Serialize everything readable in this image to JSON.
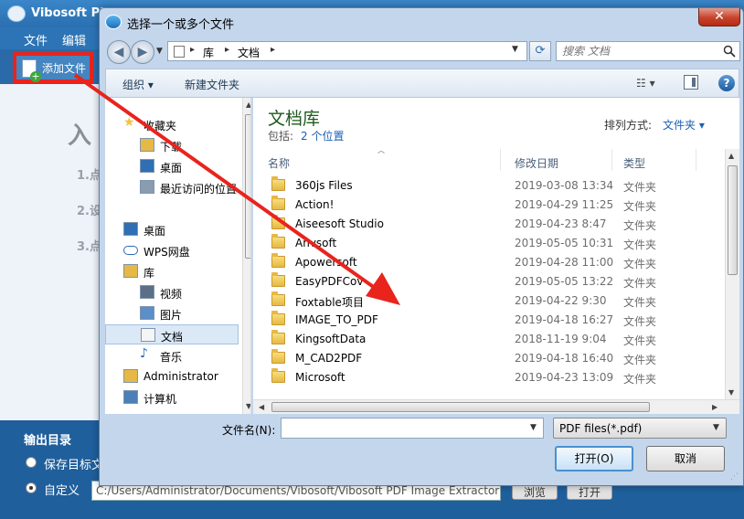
{
  "background_app": {
    "title": "Vibosoft PD",
    "menus": [
      "文件",
      "编辑"
    ],
    "add_file_label": "添加文件",
    "heading": "入",
    "steps": [
      "1.点",
      "2.设",
      "3.点"
    ],
    "output_label": "输出目录",
    "radio_options": [
      {
        "label": "保存目标文",
        "selected": false
      },
      {
        "label": "自定义",
        "selected": true
      }
    ],
    "path_value": "C:/Users/Administrator/Documents/Vibosoft/Vibosoft PDF Image Extractor",
    "buttons": [
      "浏览",
      "打开"
    ]
  },
  "dialog": {
    "title": "选择一个或多个文件",
    "close_symbol": "✕",
    "breadcrumbs": [
      "库",
      "文档"
    ],
    "search_placeholder": "搜索 文档",
    "toolbar": {
      "organize": "组织 ▾",
      "new_folder": "新建文件夹",
      "help_symbol": "?"
    },
    "nav_items": [
      {
        "label": "收藏夹",
        "icon": "star-icon",
        "level": 0,
        "selected": false
      },
      {
        "label": "下载",
        "icon": "download-folder-icon",
        "level": 1,
        "selected": false
      },
      {
        "label": "桌面",
        "icon": "desktop-icon",
        "level": 1,
        "selected": false
      },
      {
        "label": "最近访问的位置",
        "icon": "recent-places-icon",
        "level": 1,
        "selected": false
      },
      {
        "label": "桌面",
        "icon": "desktop-icon",
        "level": 0,
        "selected": false
      },
      {
        "label": "WPS网盘",
        "icon": "cloud-icon",
        "level": 0,
        "selected": false
      },
      {
        "label": "库",
        "icon": "library-icon",
        "level": 0,
        "selected": false
      },
      {
        "label": "视频",
        "icon": "video-icon",
        "level": 1,
        "selected": false
      },
      {
        "label": "图片",
        "icon": "pictures-icon",
        "level": 1,
        "selected": false
      },
      {
        "label": "文档",
        "icon": "documents-icon",
        "level": 1,
        "selected": true
      },
      {
        "label": "音乐",
        "icon": "music-icon",
        "level": 1,
        "selected": false
      },
      {
        "label": "Administrator",
        "icon": "user-folder-icon",
        "level": 0,
        "selected": false
      },
      {
        "label": "计算机",
        "icon": "computer-icon",
        "level": 0,
        "selected": false
      }
    ],
    "library": {
      "title": "文档库",
      "includes_label": "包括:",
      "includes_value": "2 个位置",
      "sort_label": "排列方式:",
      "sort_value": "文件夹 ▾"
    },
    "columns": {
      "name": "名称",
      "date": "修改日期",
      "type": "类型"
    },
    "files": [
      {
        "name": "360js Files",
        "date": "2019-03-08 13:34",
        "type": "文件夹"
      },
      {
        "name": "Action!",
        "date": "2019-04-29 11:25",
        "type": "文件夹"
      },
      {
        "name": "Aiseesoft Studio",
        "date": "2019-04-23 8:47",
        "type": "文件夹"
      },
      {
        "name": "Anvsoft",
        "date": "2019-05-05 10:31",
        "type": "文件夹"
      },
      {
        "name": "Apowersoft",
        "date": "2019-04-28 11:00",
        "type": "文件夹"
      },
      {
        "name": "EasyPDFCov",
        "date": "2019-05-05 13:22",
        "type": "文件夹"
      },
      {
        "name": "Foxtable项目",
        "date": "2019-04-22 9:30",
        "type": "文件夹"
      },
      {
        "name": "IMAGE_TO_PDF",
        "date": "2019-04-18 16:27",
        "type": "文件夹"
      },
      {
        "name": "KingsoftData",
        "date": "2018-11-19 9:04",
        "type": "文件夹"
      },
      {
        "name": "M_CAD2PDF",
        "date": "2019-04-18 16:40",
        "type": "文件夹"
      },
      {
        "name": "Microsoft",
        "date": "2019-04-23 13:09",
        "type": "文件夹"
      }
    ],
    "filename_label": "文件名(N):",
    "filename_value": "",
    "filter_value": "PDF files(*.pdf)",
    "open_button": "打开(O)",
    "cancel_button": "取消"
  },
  "colors": {
    "annotation_red": "#e8241d",
    "library_title_green": "#1e5a1e",
    "link_blue": "#1a5fb4"
  }
}
